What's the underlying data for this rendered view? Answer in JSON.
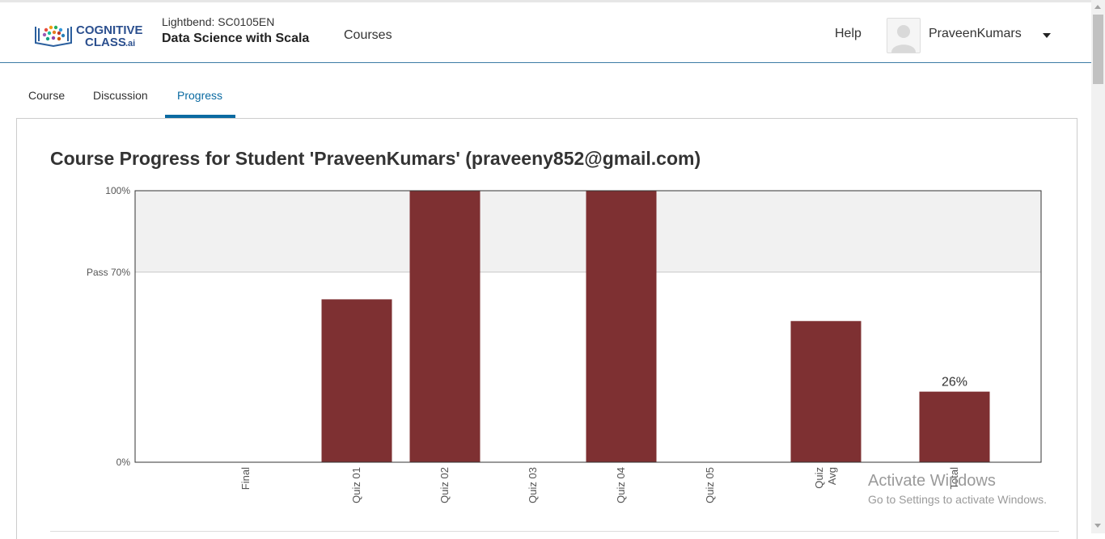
{
  "header": {
    "logo_line1": "COGNITIVE",
    "logo_line2": "CLASS",
    "logo_suffix": ".ai",
    "course_org": "Lightbend: SC0105EN",
    "course_title": "Data Science with Scala",
    "nav_courses": "Courses",
    "help": "Help",
    "username": "PraveenKumars"
  },
  "tabs": [
    {
      "label": "Course",
      "active": false
    },
    {
      "label": "Discussion",
      "active": false
    },
    {
      "label": "Progress",
      "active": true
    }
  ],
  "page": {
    "title": "Course Progress for Student 'PraveenKumars' (praveeny852@gmail.com)"
  },
  "colors": {
    "bar": "#7e3032",
    "pass_band": "#f1f1f1",
    "accent": "#0a6aa1"
  },
  "chart_data": {
    "type": "bar",
    "ylim": [
      0,
      100
    ],
    "y_ticks": [
      {
        "value": 100,
        "label": "100%"
      },
      {
        "value": 70,
        "label": "Pass 70%"
      },
      {
        "value": 0,
        "label": "0%"
      }
    ],
    "pass_threshold": 70,
    "categories": [
      [
        "Final"
      ],
      [
        "Quiz 01"
      ],
      [
        "Quiz 02"
      ],
      [
        "Quiz 03"
      ],
      [
        "Quiz 04"
      ],
      [
        "Quiz 05"
      ],
      [
        "Quiz",
        "Avg"
      ],
      [
        "Total"
      ]
    ],
    "values": [
      0,
      60,
      100,
      0,
      100,
      0,
      52,
      26
    ],
    "data_labels": [
      "",
      "",
      "",
      "",
      "",
      "",
      "",
      "26%"
    ]
  },
  "watermark": {
    "line1": "Activate Windows",
    "line2": "Go to Settings to activate Windows."
  }
}
